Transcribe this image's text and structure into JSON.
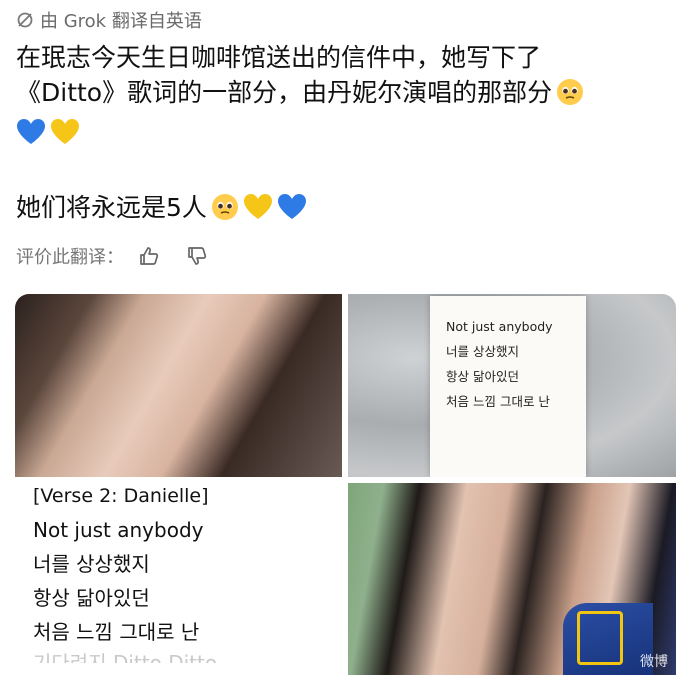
{
  "header": {
    "translated_by": "由 Grok 翻译自英语",
    "icon": "translate-slash-icon"
  },
  "post": {
    "line1": "在珉志今天生日咖啡馆送出的信件中，她写下了",
    "line2": "《Ditto》歌词的一部分，由丹妮尔演唱的那部分",
    "line4": "她们将永远是5人"
  },
  "emoji": {
    "pleading": "pleading-face-emoji",
    "blue_heart": "blue-heart-emoji",
    "yellow_heart": "yellow-heart-emoji"
  },
  "rate": {
    "label": "评价此翻译：",
    "like_icon": "thumbs-up-icon",
    "dislike_icon": "thumbs-down-icon"
  },
  "media": {
    "letter_lines": [
      "Not just anybody",
      "너를 상상했지",
      "항상 닮아있던",
      "처음 느낌 그대로 난"
    ],
    "lyrics": [
      "[Verse 2: Danielle]",
      "Not just anybody",
      "너를 상상했지",
      "항상 닮아있던",
      "처음 느낌 그대로 난"
    ],
    "lyrics_cut": "기다려지 Ditto Ditto",
    "watermark": "微博"
  },
  "colors": {
    "blue_heart": "#2f7be5",
    "yellow_heart": "#f5c518",
    "muted_text": "#6b6b6b"
  }
}
